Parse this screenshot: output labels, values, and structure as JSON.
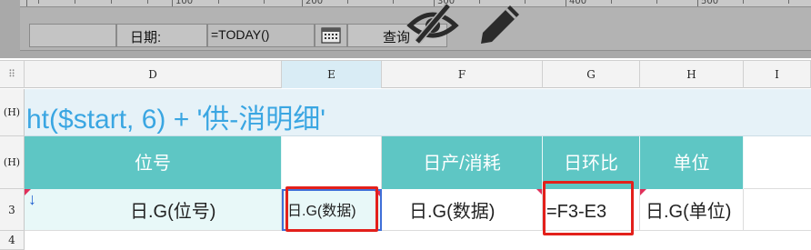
{
  "ruler": {
    "marks": [
      "100",
      "200",
      "300",
      "400",
      "500"
    ]
  },
  "toolbar": {
    "date_label": "日期:",
    "date_formula": "=TODAY()",
    "query_button": "查询",
    "calendar_icon": "calendar-icon",
    "hide_icon": "eye-slash-icon",
    "edit_icon": "pencil-icon"
  },
  "sheet": {
    "corner": "⠿",
    "columns": [
      "D",
      "E",
      "F",
      "G",
      "H",
      "I"
    ],
    "rows": [
      "(H)",
      "(H)",
      "3",
      "4"
    ],
    "title_formula": "ht($start, 6) + '供-消明细'",
    "headers": [
      "位号",
      "",
      "日产/消耗",
      "日环比",
      "单位"
    ],
    "data": [
      "日.G(位号)",
      "日.G(数据)",
      "日.G(数据)",
      "=F3-E3",
      "日.G(单位)"
    ],
    "arrow_glyph": "↓"
  },
  "colors": {
    "header_teal": "#5ec6c4",
    "title_blue": "#3aa6e2",
    "highlight": "#e3201b",
    "selected_col": "#d9ecf5"
  }
}
